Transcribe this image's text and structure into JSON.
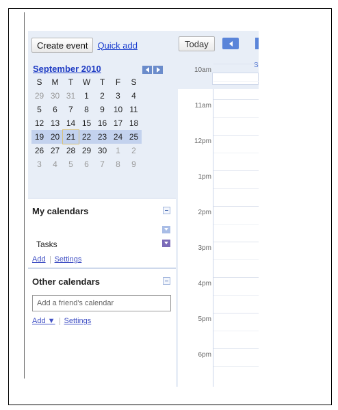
{
  "sidebar": {
    "create_event_label": "Create event",
    "quick_add_label": "Quick add",
    "month_title": "September 2010",
    "day_headers": [
      "S",
      "M",
      "T",
      "W",
      "T",
      "F",
      "S"
    ],
    "weeks": [
      [
        "29",
        "30",
        "31",
        "1",
        "2",
        "3",
        "4"
      ],
      [
        "5",
        "6",
        "7",
        "8",
        "9",
        "10",
        "11"
      ],
      [
        "12",
        "13",
        "14",
        "15",
        "16",
        "17",
        "18"
      ],
      [
        "19",
        "20",
        "21",
        "22",
        "23",
        "24",
        "25"
      ],
      [
        "26",
        "27",
        "28",
        "29",
        "30",
        "1",
        "2"
      ],
      [
        "3",
        "4",
        "5",
        "6",
        "7",
        "8",
        "9"
      ]
    ],
    "other_month_flags": [
      [
        true,
        true,
        true,
        false,
        false,
        false,
        false
      ],
      [
        false,
        false,
        false,
        false,
        false,
        false,
        false
      ],
      [
        false,
        false,
        false,
        false,
        false,
        false,
        false
      ],
      [
        false,
        false,
        false,
        false,
        false,
        false,
        false
      ],
      [
        false,
        false,
        false,
        false,
        false,
        true,
        true
      ],
      [
        true,
        true,
        true,
        true,
        true,
        true,
        true
      ]
    ],
    "today_week_index": 3,
    "today_day_index": 2,
    "my_calendars": {
      "title": "My calendars",
      "tasks_label": "Tasks",
      "add_label": "Add",
      "settings_label": "Settings",
      "first_calendar_color": "#a9bde6",
      "tasks_color": "#7b6bb8"
    },
    "other_calendars": {
      "title": "Other calendars",
      "friend_placeholder": "Add a friend's calendar",
      "add_label": "Add ▼",
      "settings_label": "Settings"
    }
  },
  "main": {
    "today_label": "Today",
    "column_letter": "S",
    "hours": [
      "10am",
      "11am",
      "12pm",
      "1pm",
      "2pm",
      "3pm",
      "4pm",
      "5pm",
      "6pm"
    ]
  },
  "colors": {
    "sidebar_bg": "#e8eef7",
    "link_blue": "#1a3ecf",
    "nav_blue": "#5b85d9"
  }
}
